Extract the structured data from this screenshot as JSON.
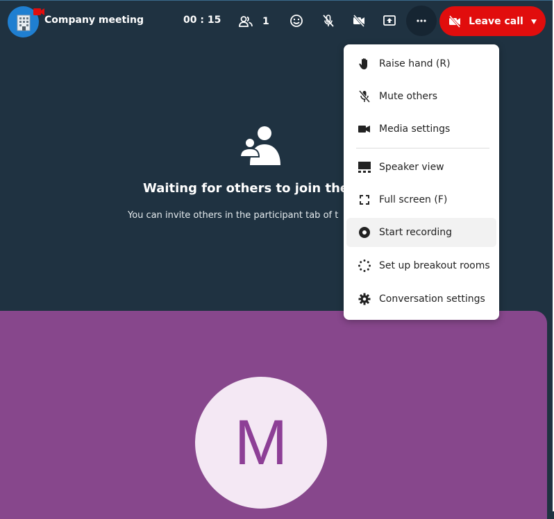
{
  "call": {
    "room_title": "Company meeting",
    "timer": "00 : 15",
    "participant_count": "1",
    "leave_label": "Leave call"
  },
  "empty_state": {
    "title": "Waiting for others to join the c",
    "description": "You can invite others in the participant tab of t"
  },
  "tile": {
    "avatar_letter": "M"
  },
  "menu": {
    "items": [
      {
        "label": "Raise hand (R)",
        "icon": "hand-icon"
      },
      {
        "label": "Mute others",
        "icon": "mic-off-icon"
      },
      {
        "label": "Media settings",
        "icon": "video-icon"
      },
      {
        "label": "Speaker view",
        "icon": "speaker-view-icon"
      },
      {
        "label": "Full screen (F)",
        "icon": "fullscreen-icon"
      },
      {
        "label": "Start recording",
        "icon": "record-icon"
      },
      {
        "label": "Set up breakout rooms",
        "icon": "breakout-icon"
      },
      {
        "label": "Conversation settings",
        "icon": "gear-icon"
      }
    ]
  },
  "colors": {
    "background": "#1f3241",
    "leave": "#e10d0d",
    "tile": "#87478c",
    "avatar_bg": "#f4e8f4",
    "avatar_letter": "#8d3f96"
  }
}
